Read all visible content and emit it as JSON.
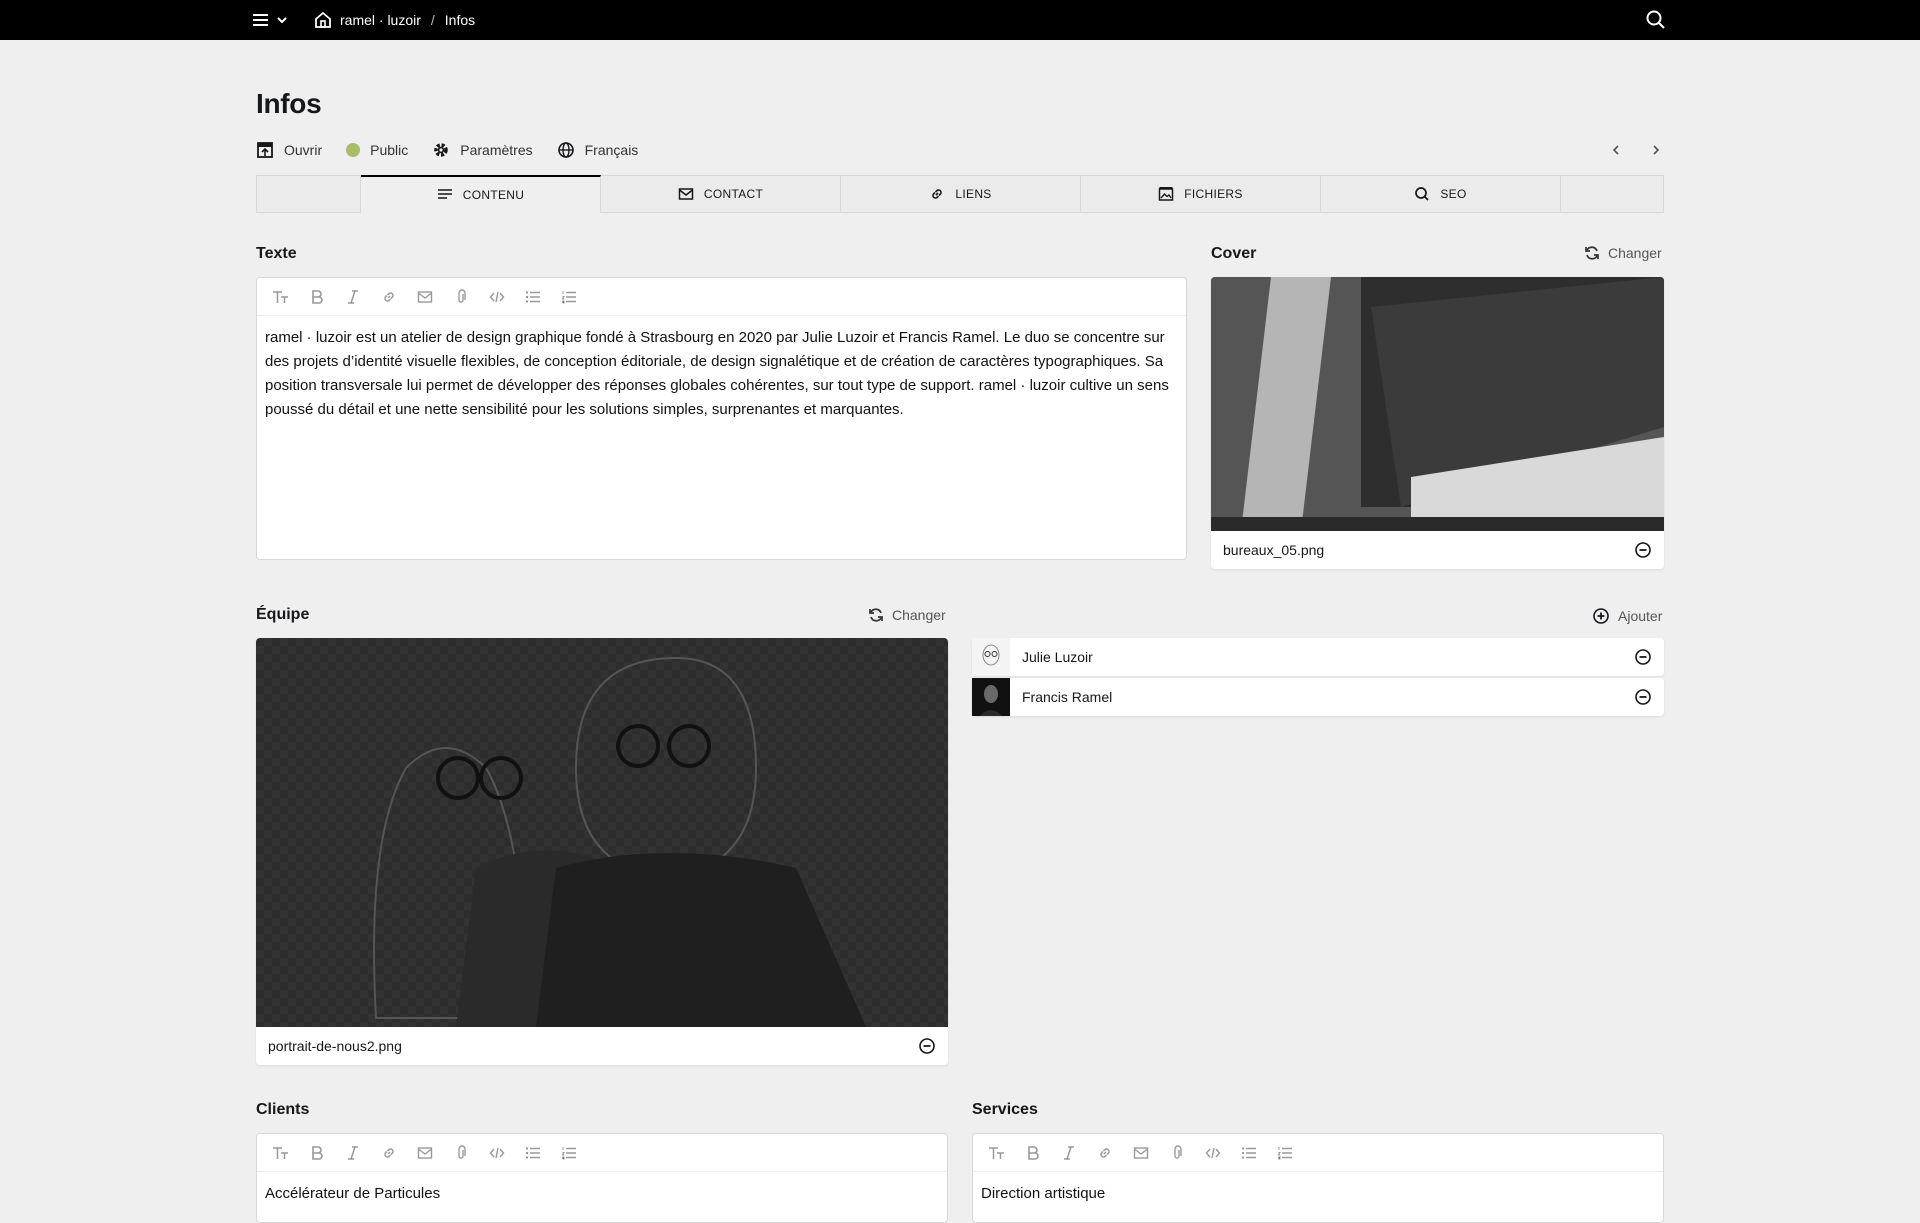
{
  "topbar": {
    "site_name": "ramel · luzoir",
    "separator": "/",
    "current": "Infos"
  },
  "page": {
    "title": "Infos",
    "actions": {
      "open": "Ouvrir",
      "status": "Public",
      "settings": "Paramètres",
      "language": "Français"
    },
    "status_color": "#a7bd68"
  },
  "tabs": [
    {
      "label": "CONTENU",
      "icon": "text-lines-icon"
    },
    {
      "label": "CONTACT",
      "icon": "envelope-icon"
    },
    {
      "label": "LIENS",
      "icon": "link-icon"
    },
    {
      "label": "FICHIERS",
      "icon": "image-icon"
    },
    {
      "label": "SEO",
      "icon": "search-icon"
    }
  ],
  "texte": {
    "label": "Texte",
    "body": "ramel · luzoir est un atelier de design graphique fondé à Strasbourg en 2020 par Julie Luzoir et Francis Ramel. Le duo se concentre sur des projets d’identité visuelle flexibles, de conception éditoriale, de design signalétique et de création de caractères typographiques. Sa position transversale lui permet de développer des réponses globales cohérentes, sur tout type de support. ramel · luzoir cultive un sens poussé du détail et une nette sensibilité pour les solutions simples, surprenantes et marquantes."
  },
  "cover": {
    "label": "Cover",
    "change": "Changer",
    "filename": "bureaux_05.png"
  },
  "equipe": {
    "label": "Équipe",
    "change": "Changer",
    "filename": "portrait-de-nous2.png",
    "add": "Ajouter",
    "members": [
      {
        "name": "Julie Luzoir"
      },
      {
        "name": "Francis Ramel"
      }
    ]
  },
  "clients": {
    "label": "Clients",
    "first_line": "Accélérateur de Particules"
  },
  "services": {
    "label": "Services",
    "first_line": "Direction artistique"
  }
}
